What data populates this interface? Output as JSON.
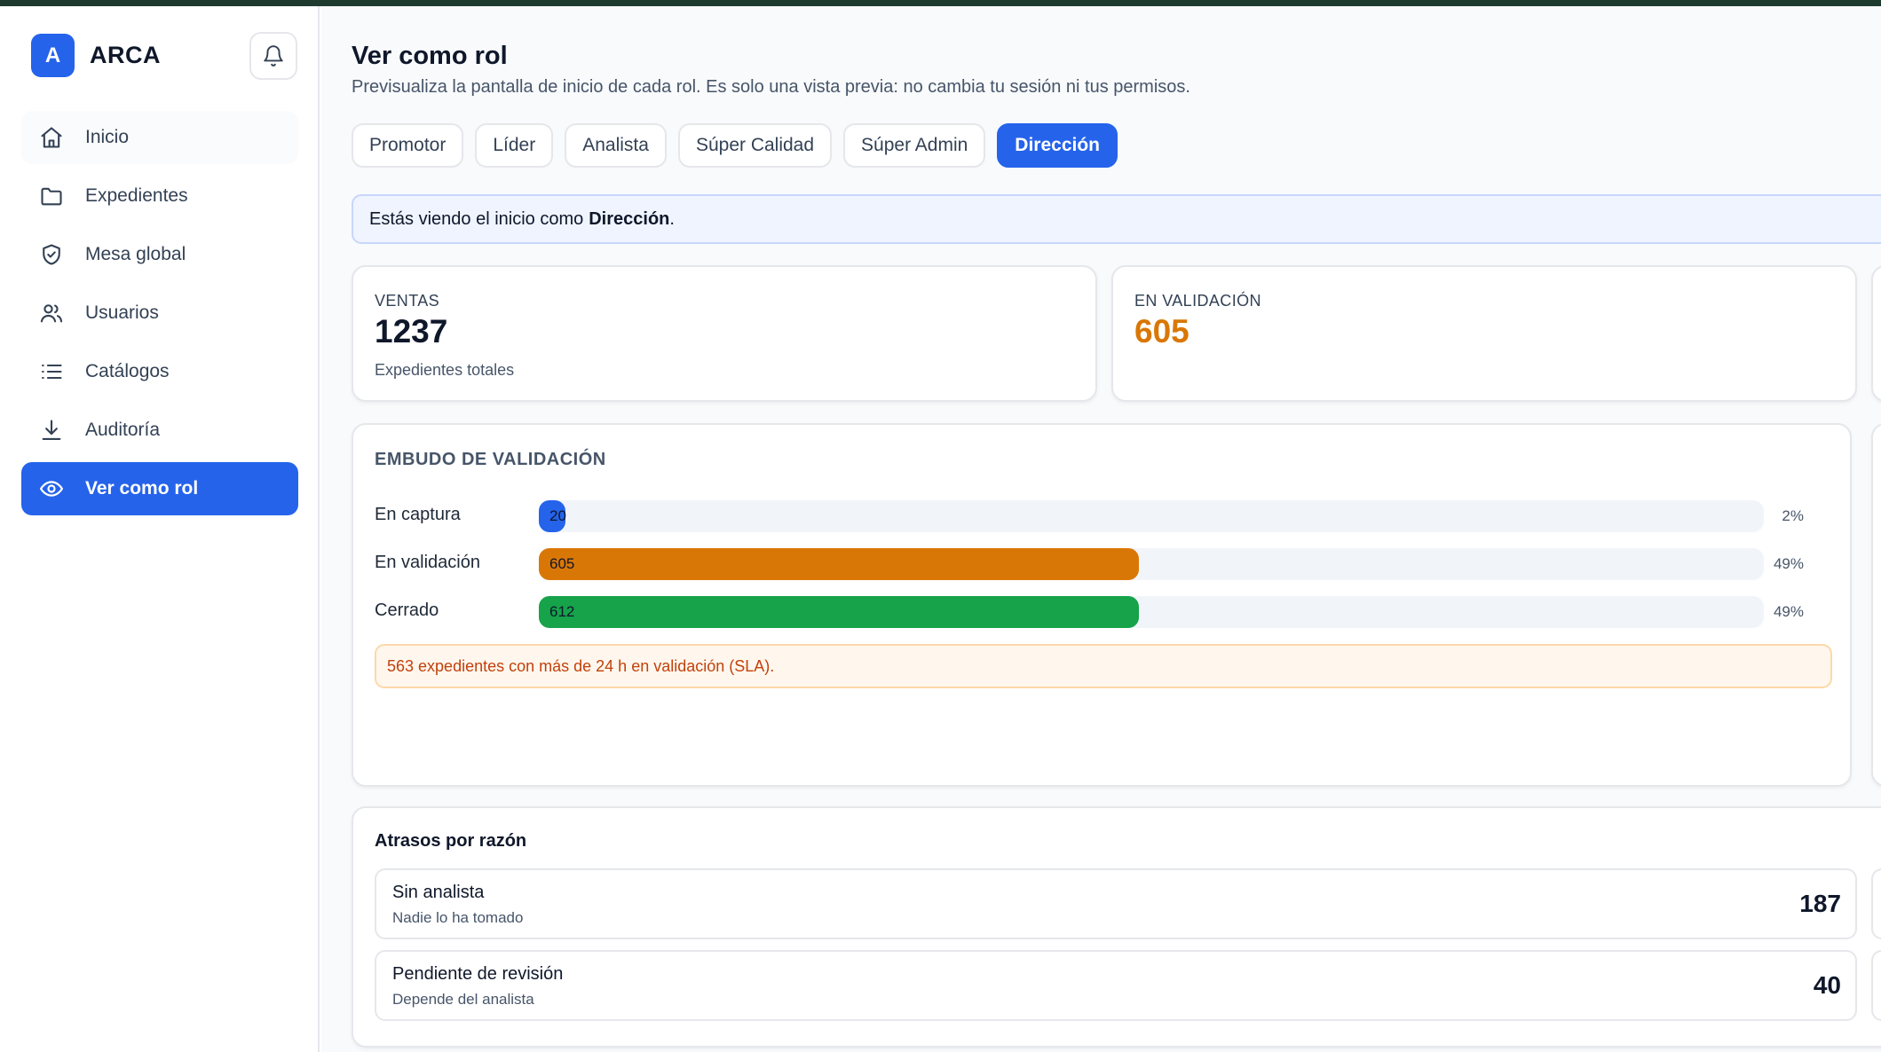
{
  "app": {
    "logo_letter": "A",
    "name": "ARCA"
  },
  "sidebar": {
    "items": [
      {
        "label": "Inicio",
        "icon": "home-icon"
      },
      {
        "label": "Expedientes",
        "icon": "folder-icon"
      },
      {
        "label": "Mesa global",
        "icon": "shield-icon"
      },
      {
        "label": "Usuarios",
        "icon": "users-icon"
      },
      {
        "label": "Catálogos",
        "icon": "list-icon"
      },
      {
        "label": "Auditoría",
        "icon": "download-icon"
      },
      {
        "label": "Ver como rol",
        "icon": "eye-icon",
        "active": true
      }
    ]
  },
  "page": {
    "title": "Ver como rol",
    "subtitle": "Previsualiza la pantalla de inicio de cada rol. Es solo una vista previa: no cambia tu sesión ni tus permisos."
  },
  "tabs": [
    {
      "label": "Promotor"
    },
    {
      "label": "Líder"
    },
    {
      "label": "Analista"
    },
    {
      "label": "Súper Calidad"
    },
    {
      "label": "Súper Admin"
    },
    {
      "label": "Dirección",
      "active": true
    }
  ],
  "notice": {
    "prefix": "Estás viendo el inicio como",
    "role": "Dirección",
    "suffix": "."
  },
  "stats": {
    "ventas": {
      "label": "VENTAS",
      "value": "1237",
      "note": "Expedientes totales"
    },
    "validacion": {
      "label": "EN VALIDACIÓN",
      "value": "605"
    }
  },
  "funnel": {
    "title": "EMBUDO DE VALIDACIÓN",
    "rows": [
      {
        "label": "En captura",
        "count": "20",
        "pct": "2%",
        "fraction": 0.02,
        "color": "#2563eb"
      },
      {
        "label": "En validación",
        "count": "605",
        "pct": "49%",
        "fraction": 0.49,
        "color": "#d97706"
      },
      {
        "label": "Cerrado",
        "count": "612",
        "pct": "49%",
        "fraction": 0.49,
        "color": "#16a34a"
      }
    ],
    "sla": "563 expedientes con más de 24 h en validación (SLA)."
  },
  "delays": {
    "title": "Atrasos por razón",
    "rows": [
      {
        "title": "Sin analista",
        "sub": "Nadie lo ha tomado",
        "value": "187"
      },
      {
        "title": "Pendiente de revisión",
        "sub": "Depende del analista",
        "value": "40"
      }
    ]
  },
  "colors": {
    "accent": "#2563eb",
    "warning": "#d97706",
    "success": "#16a34a"
  }
}
